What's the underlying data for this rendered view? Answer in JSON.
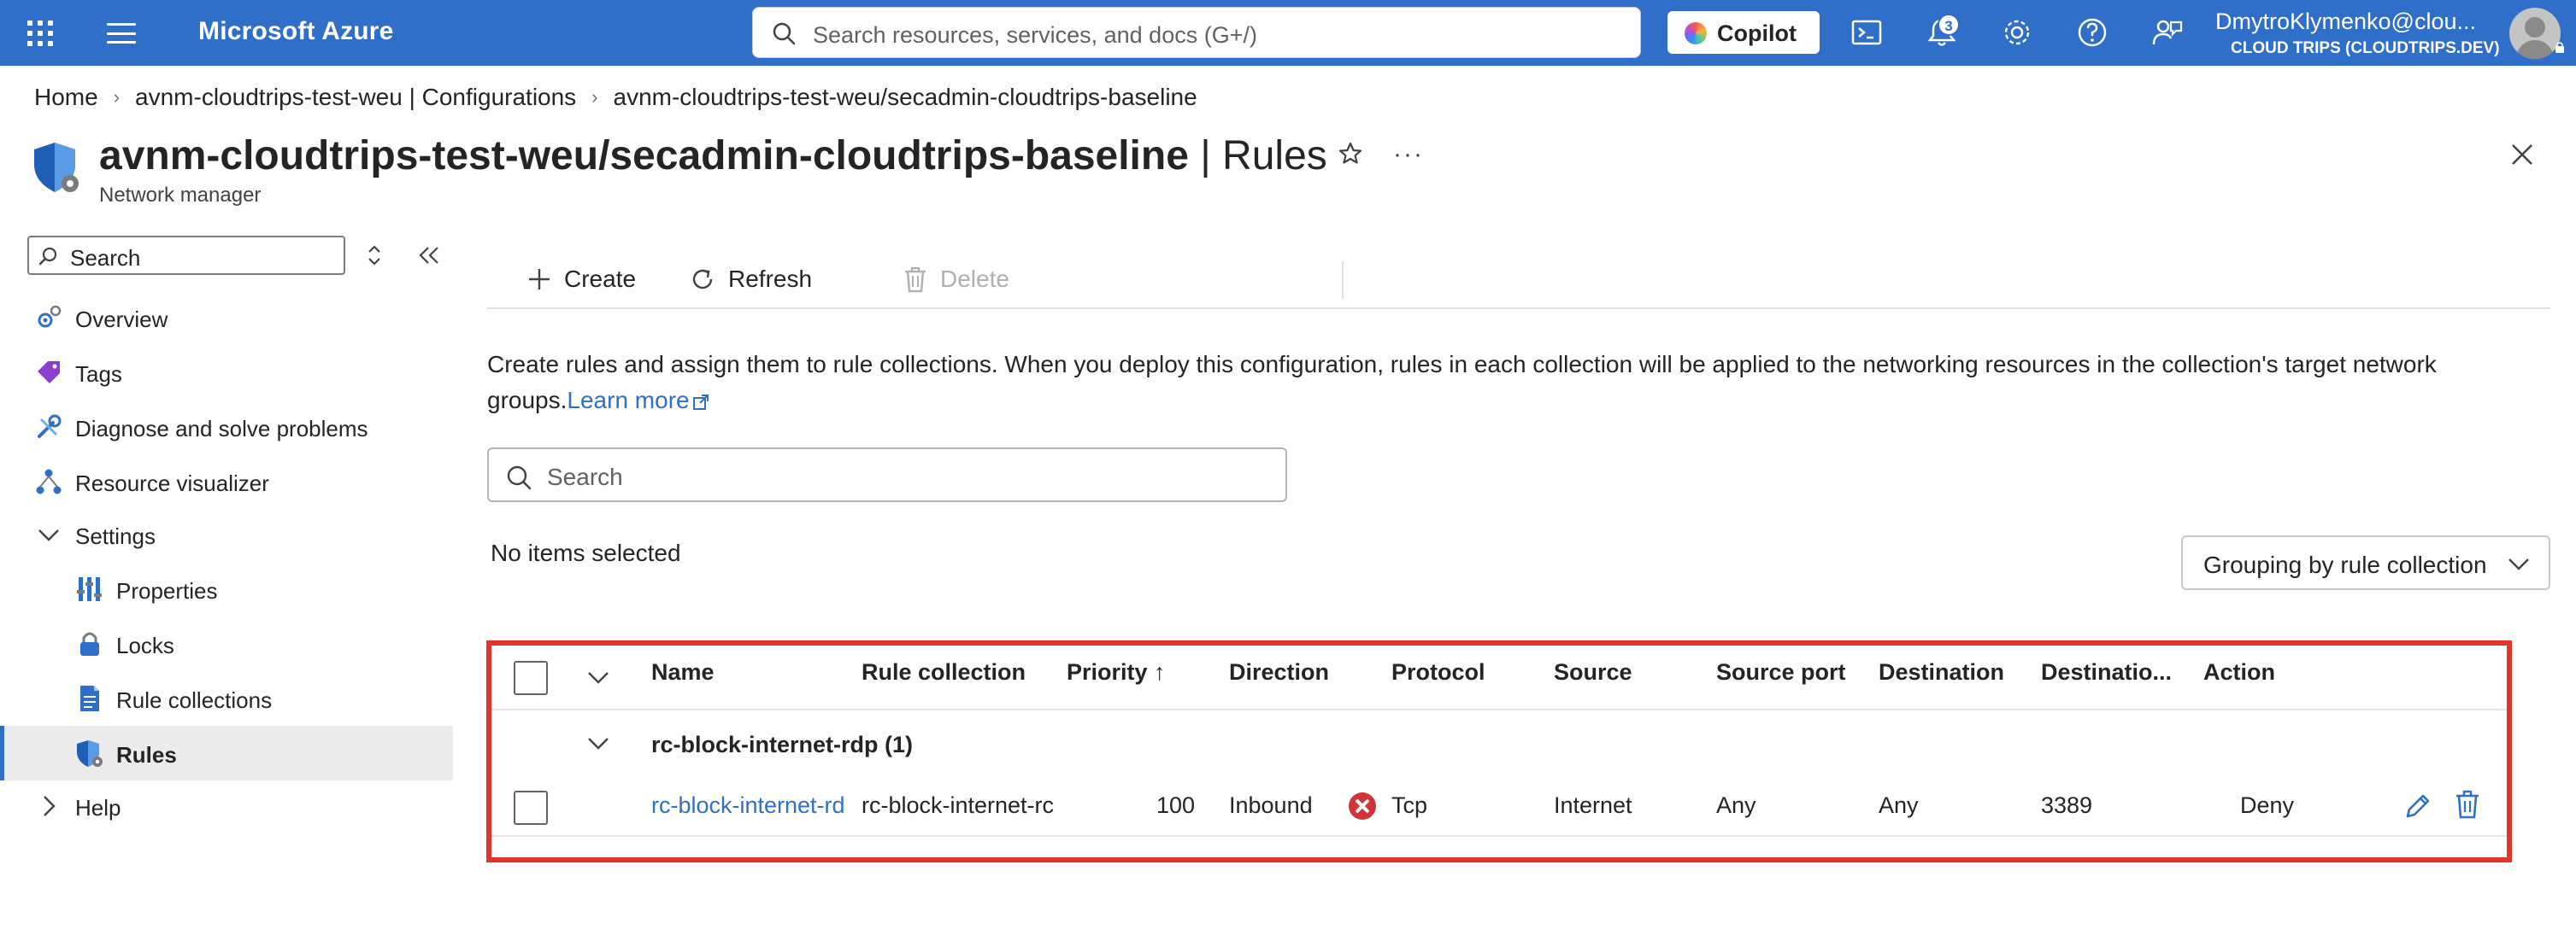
{
  "topbar": {
    "brand": "Microsoft Azure",
    "search_placeholder": "Search resources, services, and docs (G+/)",
    "copilot_label": "Copilot",
    "notifications_count": "3",
    "user_email": "DmytroKlymenko@clou...",
    "user_tenant": "CLOUD TRIPS (CLOUDTRIPS.DEV)",
    "bar_color": "#2f6fc9"
  },
  "breadcrumb": {
    "items": [
      "Home",
      "avnm-cloudtrips-test-weu | Configurations",
      "avnm-cloudtrips-test-weu/secadmin-cloudtrips-baseline"
    ]
  },
  "header": {
    "title_bold": "avnm-cloudtrips-test-weu/secadmin-cloudtrips-baseline",
    "title_suffix": " | Rules",
    "subtitle": "Network manager"
  },
  "sidebar": {
    "search_placeholder": "Search",
    "items": [
      {
        "label": "Overview",
        "icon": "overview-icon"
      },
      {
        "label": "Tags",
        "icon": "tag-icon"
      },
      {
        "label": "Diagnose and solve problems",
        "icon": "wrench-icon"
      },
      {
        "label": "Resource visualizer",
        "icon": "hierarchy-icon"
      },
      {
        "label": "Settings",
        "icon": "chevron-down-icon"
      },
      {
        "label": "Properties",
        "icon": "properties-icon"
      },
      {
        "label": "Locks",
        "icon": "lock-icon"
      },
      {
        "label": "Rule collections",
        "icon": "document-icon"
      },
      {
        "label": "Rules",
        "icon": "shield-icon"
      },
      {
        "label": "Help",
        "icon": "chevron-right-icon"
      }
    ],
    "selected": "Rules"
  },
  "toolbar": {
    "create": "Create",
    "refresh": "Refresh",
    "delete": "Delete"
  },
  "description": {
    "text": "Create rules and assign them to rule collections. When you deploy this configuration, rules in each collection will be applied to the networking resources in the collection's target network groups.",
    "link": "Learn more"
  },
  "rules_search": {
    "placeholder": "Search"
  },
  "selection_status": "No items selected",
  "grouping_dropdown": {
    "selected": "Grouping by rule collection"
  },
  "table": {
    "columns": [
      "Name",
      "Rule collection",
      "Priority ↑",
      "Direction",
      "Protocol",
      "Source",
      "Source port",
      "Destination",
      "Destinatio...",
      "Action"
    ],
    "group": {
      "label": "rc-block-internet-rdp (1)"
    },
    "rows": [
      {
        "name": "rc-block-internet-rd",
        "rule_collection": "rc-block-internet-rc",
        "priority": "100",
        "direction": "Inbound",
        "protocol": "Tcp",
        "source": "Internet",
        "source_port": "Any",
        "destination": "Any",
        "destination_port": "3389",
        "action": "Deny"
      }
    ]
  },
  "highlight_color": "#e2352a"
}
